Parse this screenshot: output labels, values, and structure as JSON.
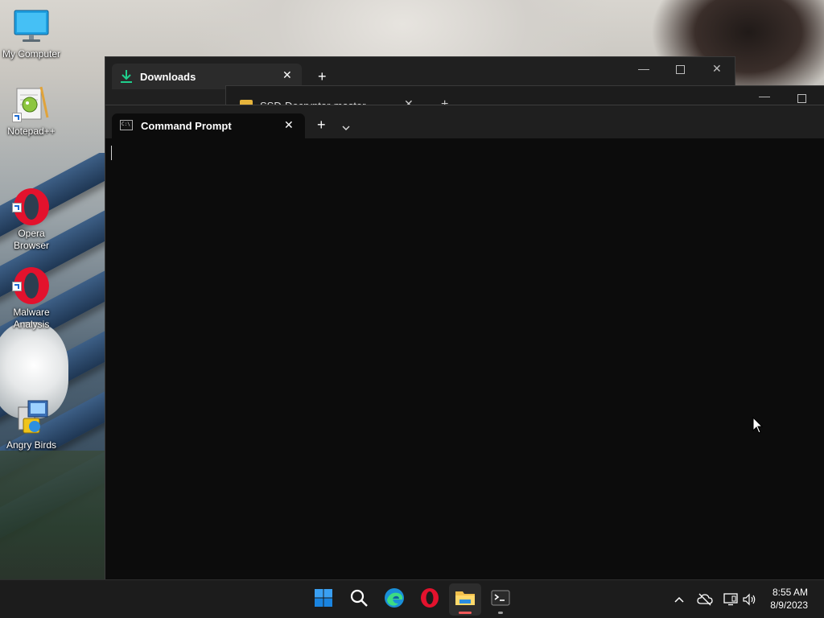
{
  "desktop": {
    "icons": [
      {
        "label": "My Computer",
        "icon": "monitor-icon"
      },
      {
        "label": "Notepad++",
        "icon": "notepadpp-icon"
      },
      {
        "label": "Opera\nBrowser",
        "icon": "opera-icon"
      },
      {
        "label": "Malware\nAnalysis",
        "icon": "opera-icon"
      },
      {
        "label": "Angry Birds",
        "icon": "installer-icon"
      }
    ]
  },
  "windows": {
    "downloads": {
      "tab_label": "Downloads"
    },
    "explorer2": {
      "tab_label": "SSD-Decrypter-master"
    },
    "terminal": {
      "tab_label": "Command Prompt",
      "content": ""
    }
  },
  "taskbar": {
    "apps": [
      "start-icon",
      "search-icon",
      "edge-icon",
      "opera-icon",
      "file-explorer-icon",
      "terminal-icon"
    ],
    "clock": {
      "time": "8:55 AM",
      "date": "8/9/2023"
    }
  },
  "colors": {
    "accent": "#0078d4",
    "terminal_bg": "#0c0c0c",
    "taskbar_bg": "#1c1c1c",
    "downloads_icon": "#1fcf8c"
  }
}
